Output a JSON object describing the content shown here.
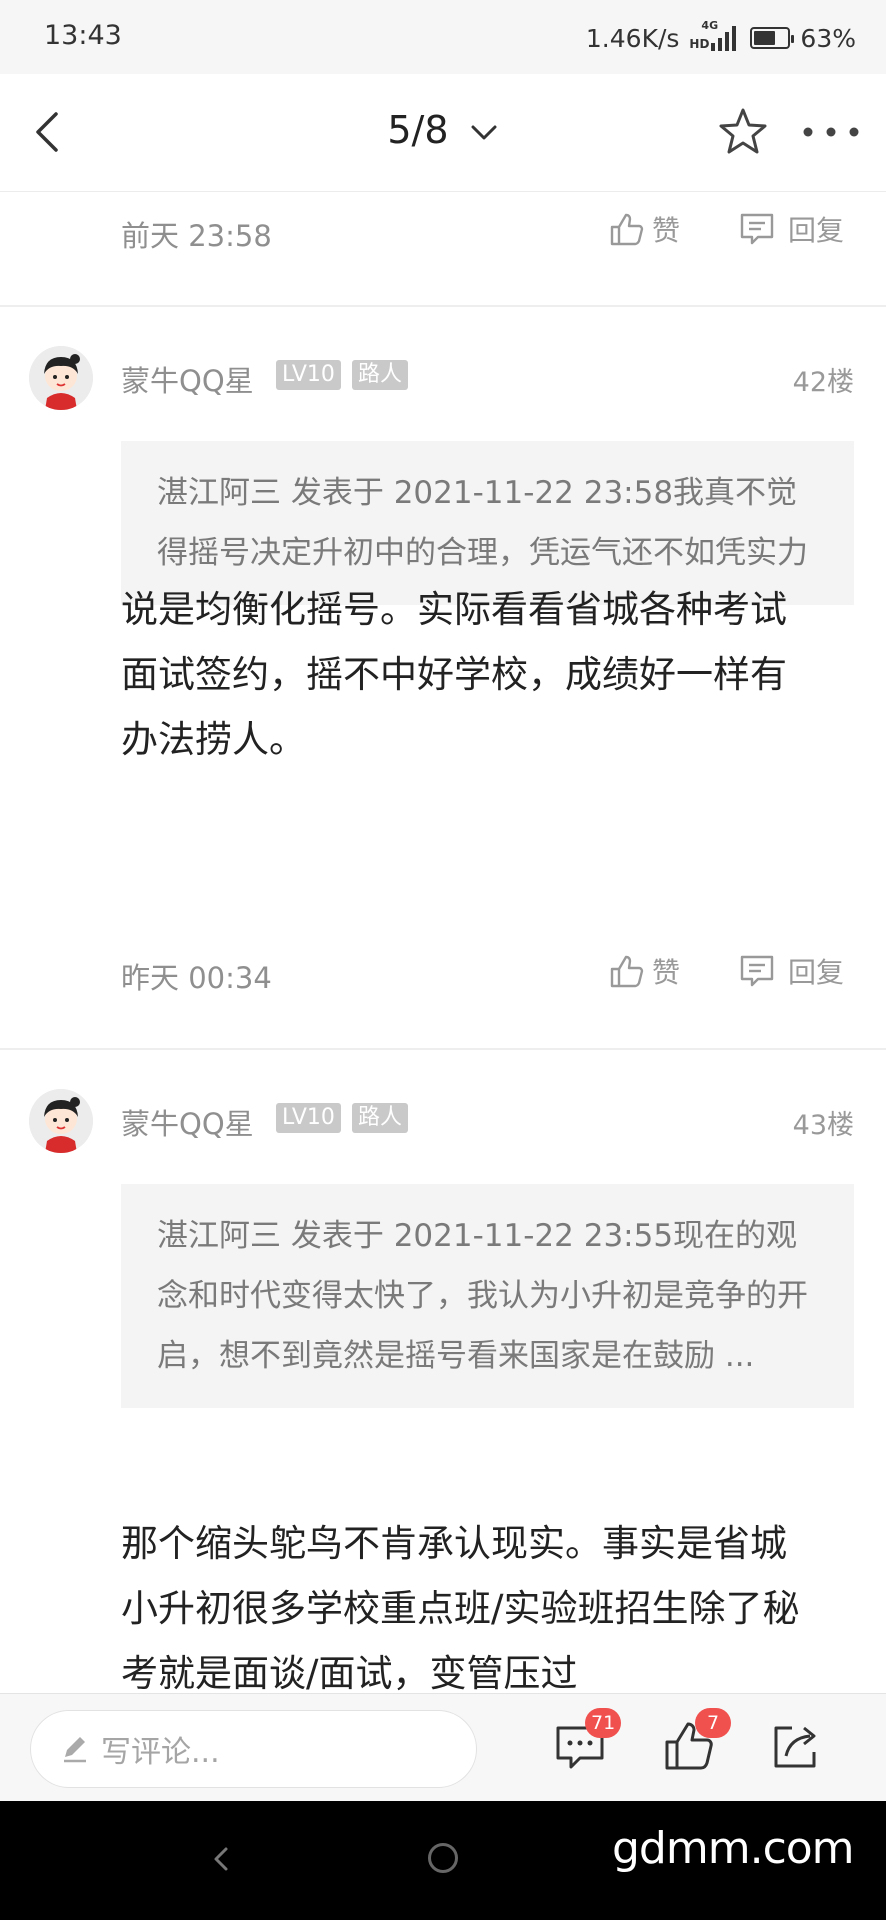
{
  "status_bar": {
    "time": "13:43",
    "net_speed": "1.46K/s",
    "hd_label": "HD",
    "network": "4G",
    "battery": "63%",
    "battery_level": 0.63
  },
  "nav": {
    "title": "5/8",
    "back_icon": "chevron-left-icon",
    "star_icon": "star-icon",
    "more_icon": "more-dots-icon"
  },
  "prev_meta": {
    "time": "前天 23:58",
    "like": "赞",
    "reply": "回复"
  },
  "posts": [
    {
      "username": "蒙牛QQ星",
      "level": "LV10",
      "rank": "路人",
      "floor": "42楼",
      "quote": "湛江阿三 发表于 2021-11-22 23:58我真不觉得摇号决定升初中的合理，凭运气还不如凭实力",
      "body": "说是均衡化摇号。实际看看省城各种考试面试签约，摇不中好学校，成绩好一样有办法捞人。",
      "time": "昨天 00:34",
      "like": "赞",
      "reply": "回复"
    },
    {
      "username": "蒙牛QQ星",
      "level": "LV10",
      "rank": "路人",
      "floor": "43楼",
      "quote": "湛江阿三 发表于 2021-11-22 23:55现在的观念和时代变得太快了，我认为小升初是竞争的开启，想不到竟然是摇号看来国家是在鼓励 ...",
      "body": "那个缩头鸵鸟不肯承认现实。事实是省城小升初很多学校重点班/实验班招生除了秘考就是面谈/面试，变管压过"
    }
  ],
  "bottom_bar": {
    "comment_placeholder": "写评论...",
    "comments_count": "71",
    "likes_count": "7"
  },
  "watermark": "gdmm.com"
}
